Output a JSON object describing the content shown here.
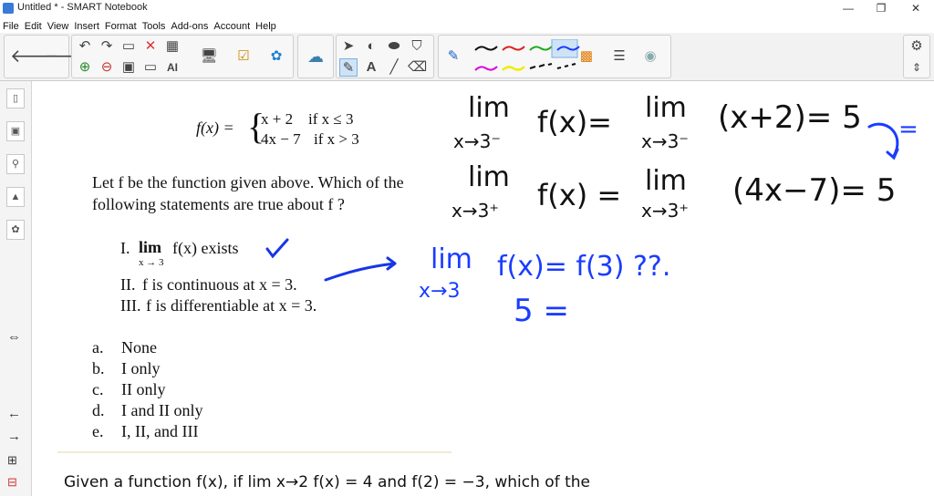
{
  "window": {
    "title": "Untitled * - SMART Notebook",
    "minimize": "—",
    "maximize": "❐",
    "close": "✕"
  },
  "menu": [
    "File",
    "Edit",
    "View",
    "Insert",
    "Format",
    "Tools",
    "Add-ons",
    "Account",
    "Help"
  ],
  "toolbar": {
    "text_tool_label": "A",
    "ai_label": "AI"
  },
  "colors": {
    "accent": "#1f5fd6",
    "ink_black": "#111111",
    "ink_blue": "#1a3cff",
    "check_blue": "#1736e6"
  },
  "problem": {
    "function_name": "f(x) =",
    "case1_expr": "x + 2",
    "case1_cond": "if x ≤ 3",
    "case2_expr": "4x − 7",
    "case2_cond": "if x > 3",
    "prompt_line1": "Let f be the function given above. Which of the",
    "prompt_line2": "following statements are true about f ?",
    "statements": [
      {
        "num": "I.",
        "lim": "lim",
        "sub": "x → 3",
        "text": "f(x)  exists"
      },
      {
        "num": "II.",
        "text": "f is continuous at x = 3."
      },
      {
        "num": "III.",
        "text": "f is differentiable at x = 3."
      }
    ],
    "choices": [
      {
        "letter": "a.",
        "text": "None"
      },
      {
        "letter": "b.",
        "text": "I only"
      },
      {
        "letter": "c.",
        "text": "II only"
      },
      {
        "letter": "d.",
        "text": "I and II only"
      },
      {
        "letter": "e.",
        "text": "I, II, and III"
      }
    ],
    "next_question": "Given a function f(x), if lim x→2 f(x) = 4 and f(2) = −3, which of the"
  },
  "handwriting": {
    "row1": {
      "lim": "lim",
      "sub": "x→3⁻",
      "lhs": "f(x)=",
      "lim2": "lim",
      "sub2": "x→3⁻",
      "rhs": "(x+2)= 5"
    },
    "row2": {
      "lim": "lim",
      "sub": "x→3⁺",
      "lhs": "f(x) =",
      "lim2": "lim",
      "sub2": "x→3⁺",
      "rhs": "(4x−7)= 5"
    },
    "eq_mark": "=",
    "row3": {
      "lim": "lim",
      "sub": "x→3",
      "text": "f(x)= f(3) ??."
    },
    "row4": "5 ="
  }
}
